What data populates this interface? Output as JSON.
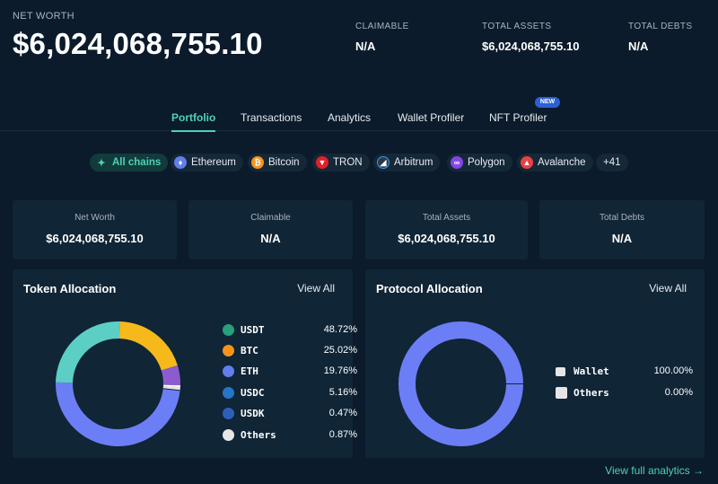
{
  "header": {
    "net_worth_label": "NET WORTH",
    "net_worth_value": "$6,024,068,755.10",
    "stats": [
      {
        "label": "CLAIMABLE",
        "value": "N/A"
      },
      {
        "label": "TOTAL ASSETS",
        "value": "$6,024,068,755.10"
      },
      {
        "label": "TOTAL DEBTS",
        "value": "N/A"
      }
    ]
  },
  "tabs": [
    {
      "label": "Portfolio",
      "active": true
    },
    {
      "label": "Transactions"
    },
    {
      "label": "Analytics"
    },
    {
      "label": "Wallet Profiler"
    },
    {
      "label": "NFT Profiler",
      "badge": "NEW"
    }
  ],
  "chains": [
    {
      "label": "All chains",
      "icon": "sparkle-icon",
      "active": true
    },
    {
      "label": "Ethereum",
      "icon": "ethereum-icon",
      "color": "#627eea"
    },
    {
      "label": "Bitcoin",
      "icon": "bitcoin-icon",
      "color": "#f7931a"
    },
    {
      "label": "TRON",
      "icon": "tron-icon",
      "color": "#e0202a"
    },
    {
      "label": "Arbitrum",
      "icon": "arbitrum-icon",
      "color": "#2d374b"
    },
    {
      "label": "Polygon",
      "icon": "polygon-icon",
      "color": "#8247e5"
    },
    {
      "label": "Avalanche",
      "icon": "avalanche-icon",
      "color": "#e84142"
    },
    {
      "label": "+41"
    }
  ],
  "summary": [
    {
      "label": "Net Worth",
      "value": "$6,024,068,755.10"
    },
    {
      "label": "Claimable",
      "value": "N/A"
    },
    {
      "label": "Total Assets",
      "value": "$6,024,068,755.10"
    },
    {
      "label": "Total Debts",
      "value": "N/A"
    }
  ],
  "token_allocation": {
    "title": "Token Allocation",
    "view_all": "View All",
    "items": [
      {
        "name": "USDT",
        "percent": "48.72%",
        "value": 48.72,
        "color": "#6c7ef5",
        "icon": "usdt-icon",
        "icon_color": "#26a17b"
      },
      {
        "name": "BTC",
        "percent": "25.02%",
        "value": 25.02,
        "color": "#5ccfc4",
        "icon": "bitcoin-icon",
        "icon_color": "#f7931a"
      },
      {
        "name": "ETH",
        "percent": "19.76%",
        "value": 19.76,
        "color": "#f5b91c",
        "icon": "ethereum-icon",
        "icon_color": "#627eea"
      },
      {
        "name": "USDC",
        "percent": "5.16%",
        "value": 5.16,
        "color": "#8c5ccf",
        "icon": "usdc-icon",
        "icon_color": "#2775ca"
      },
      {
        "name": "USDK",
        "percent": "0.47%",
        "value": 0.47,
        "color": "#ffffff",
        "icon": "usdk-icon",
        "icon_color": "#2d5fb8"
      },
      {
        "name": "Others",
        "percent": "0.87%",
        "value": 0.87,
        "color": "#e6e6e6",
        "icon": "others-icon",
        "icon_color": "#e6e6e6"
      }
    ]
  },
  "protocol_allocation": {
    "title": "Protocol Allocation",
    "view_all": "View All",
    "items": [
      {
        "name": "Wallet",
        "percent": "100.00%",
        "value": 100.0,
        "color": "#6c7ef5",
        "icon": "wallet-icon"
      },
      {
        "name": "Others",
        "percent": "0.00%",
        "value": 0.0,
        "color": "#e6e6e6",
        "icon": "others-icon"
      }
    ]
  },
  "footer": {
    "link": "View full analytics",
    "arrow": "→"
  }
}
